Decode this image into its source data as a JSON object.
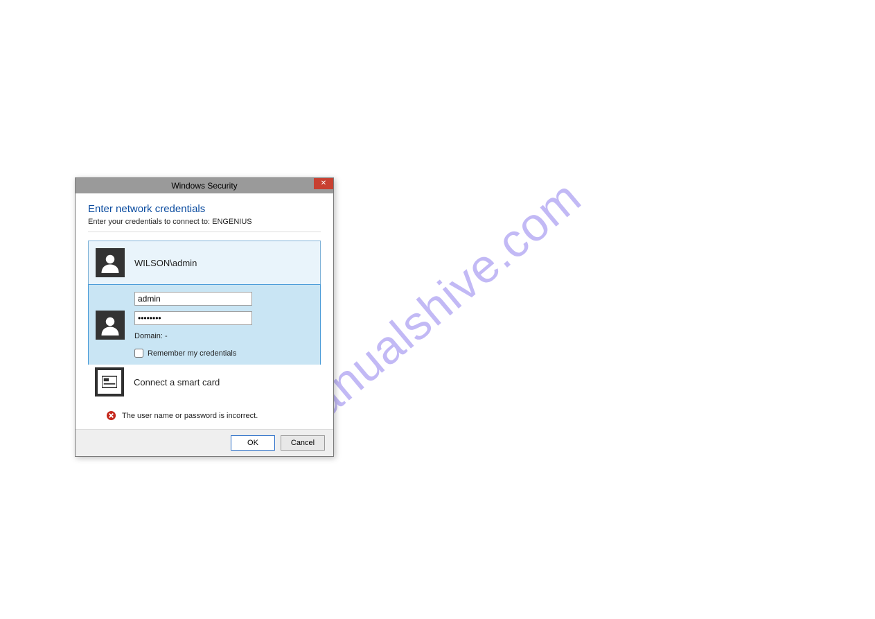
{
  "watermark": "manualshive.com",
  "dialog": {
    "title": "Windows Security",
    "heading": "Enter network credentials",
    "subtext": "Enter your credentials to connect to: ENGENIUS",
    "saved_account": "WILSON\\admin",
    "username_value": "admin",
    "password_value": "••••••••",
    "domain_label": "Domain: -",
    "remember_label": "Remember my credentials",
    "smartcard_label": "Connect a smart card",
    "error_text": "The user name or password is incorrect.",
    "ok_label": "OK",
    "cancel_label": "Cancel"
  }
}
